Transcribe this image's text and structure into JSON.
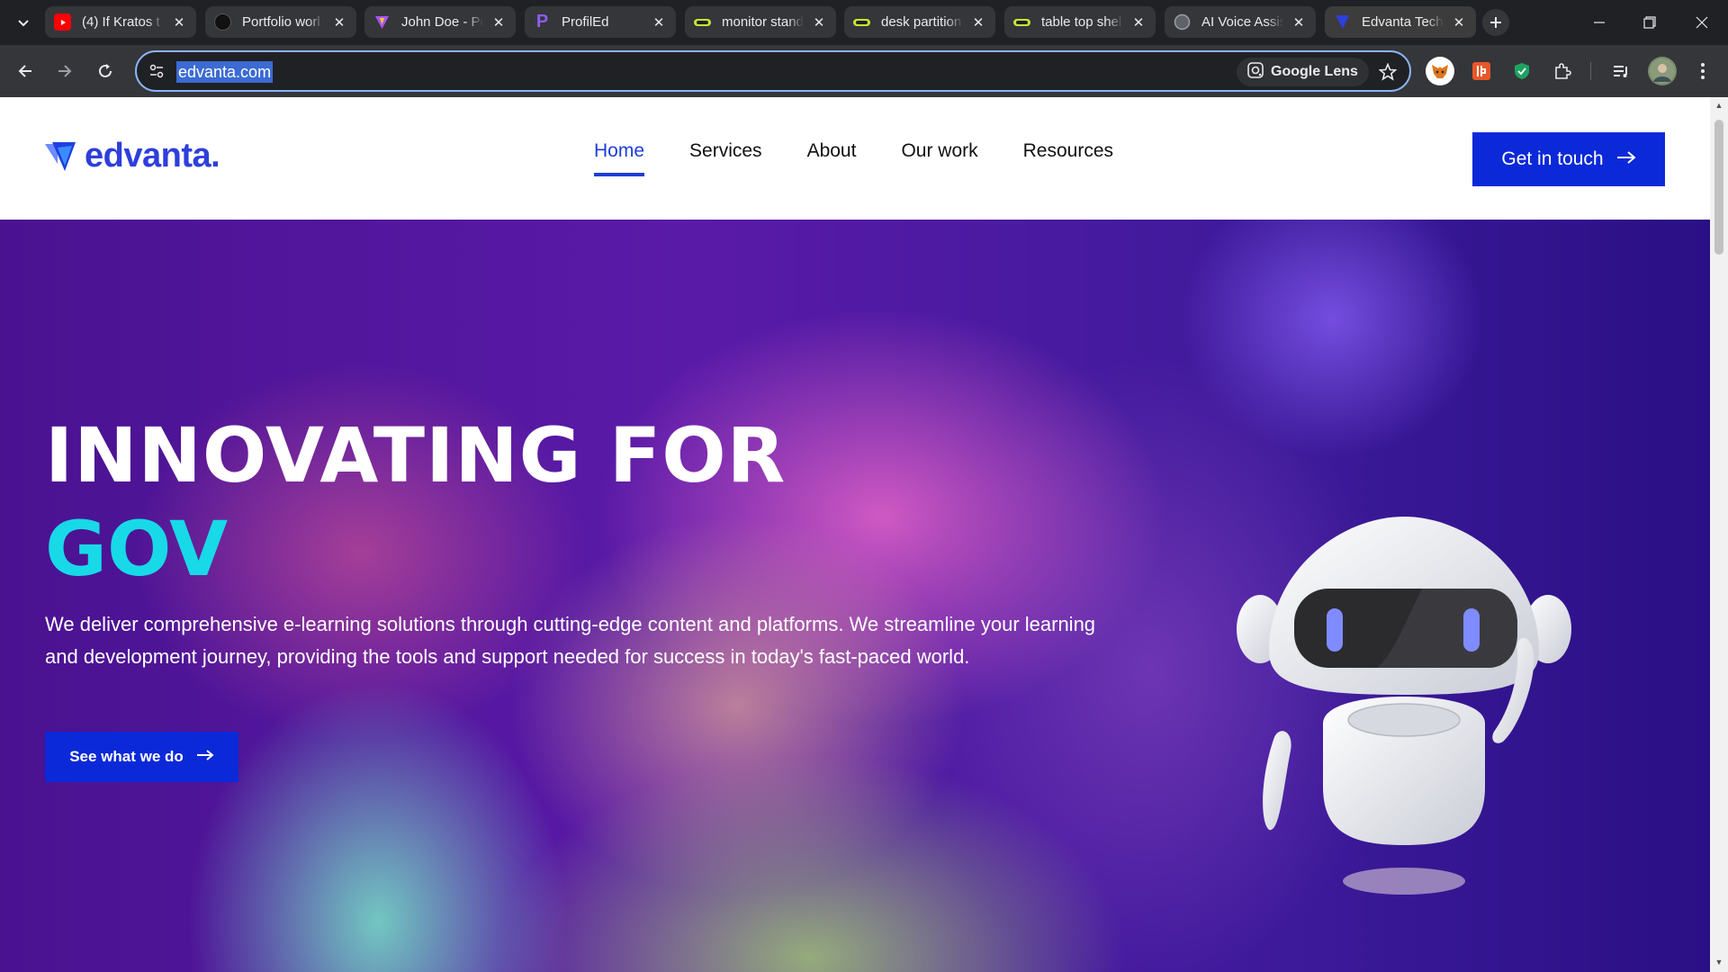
{
  "browser": {
    "tabs": [
      {
        "title": "(4) If Kratos t",
        "favicon": "youtube-icon",
        "color": "#ff0000"
      },
      {
        "title": "Portfolio worl",
        "favicon": "portfolio-icon",
        "color": "#111111"
      },
      {
        "title": "John Doe - Po",
        "favicon": "vite-icon",
        "color": "#a855f7"
      },
      {
        "title": "ProfilEd",
        "favicon": "profiled-icon",
        "color": "#8b5cf6"
      },
      {
        "title": "monitor stand",
        "favicon": "shop-icon",
        "color": "#c8e632"
      },
      {
        "title": "desk partition",
        "favicon": "shop-icon",
        "color": "#c8e632"
      },
      {
        "title": "table top shel",
        "favicon": "shop-icon",
        "color": "#c8e632"
      },
      {
        "title": "AI Voice Assis",
        "favicon": "globe-icon",
        "color": "#9aa0a6"
      },
      {
        "title": "Edvanta Tech",
        "favicon": "edvanta-icon",
        "color": "#2e3fdb"
      }
    ],
    "url": "edvanta.com",
    "lens_label": "Google Lens"
  },
  "site": {
    "logo_text": "edvanta.",
    "nav": [
      "Home",
      "Services",
      "About",
      "Our work",
      "Resources"
    ],
    "cta_label": "Get in touch"
  },
  "hero": {
    "title_line1": "INNOVATING FOR",
    "title_line2": "GOV",
    "description": "We deliver comprehensive e-learning solutions through cutting-edge content and platforms. We streamline your learning and development journey, providing the tools and support needed for success in today's fast-paced world.",
    "button_label": "See what we do"
  },
  "colors": {
    "brand": "#0b29d8",
    "accent_cyan": "#18d9e8",
    "logo": "#2e3fdb"
  }
}
